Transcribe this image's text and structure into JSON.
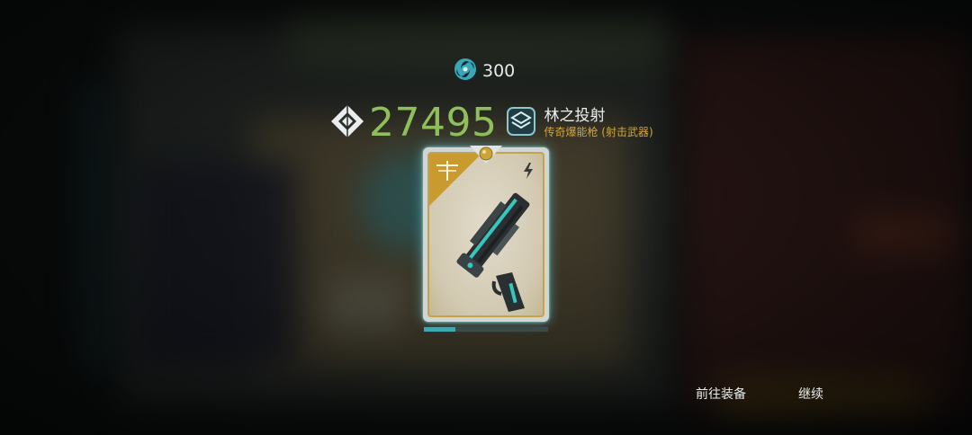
{
  "currency": {
    "icon": "swirl-currency-icon",
    "amount": "300"
  },
  "item": {
    "power_icon": "diamond-power-icon",
    "power": "27495",
    "type_icon": "weapon-type-icon",
    "name": "林之投射",
    "subtitle": "传奇爆能枪 (射击武器)",
    "card": {
      "class_icon": "dragonfly-icon",
      "element_icon": "lightning-icon",
      "slot_icon": "gold-orb-icon",
      "art": "teal-blaster-pistol"
    },
    "progress": 0.25
  },
  "buttons": {
    "equip": "前往装备",
    "continue": "继续"
  },
  "colors": {
    "power": "#8fbf5a",
    "legendary": "#d4a63a",
    "accent": "#3fa8b0",
    "glow": "#78dce6"
  }
}
